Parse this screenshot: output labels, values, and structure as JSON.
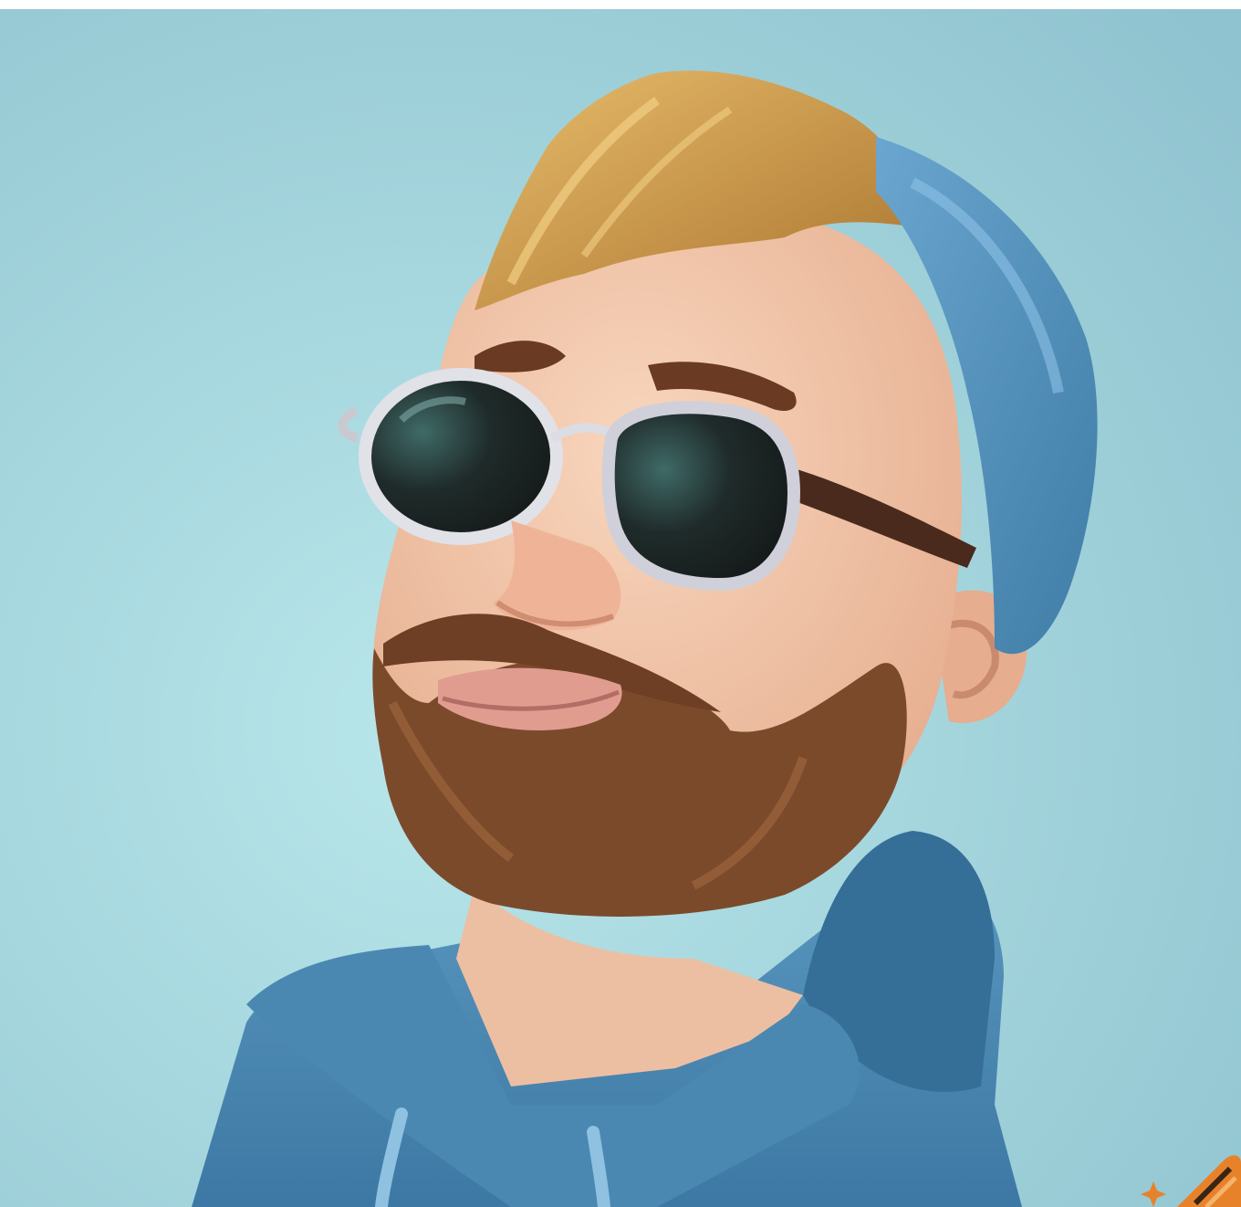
{
  "image": {
    "subject": "cartoon-man-portrait",
    "palette": {
      "background": "#9ccfd6",
      "background_light": "#b8e6ea",
      "skin": "#f1c4a6",
      "skin_shadow": "#d99a7e",
      "hair": "#c7903f",
      "hair_highlight": "#e3b56a",
      "beard": "#7a4a2b",
      "beanie": "#4f8fb8",
      "hoodie": "#4d8ab3",
      "hoodie_shadow": "#2f6a91",
      "lens": "#1f2a2b",
      "frame": "#d9d9de",
      "badge": "#e8822a"
    },
    "icons": {
      "badge": "pencil-sparkle-icon"
    }
  }
}
